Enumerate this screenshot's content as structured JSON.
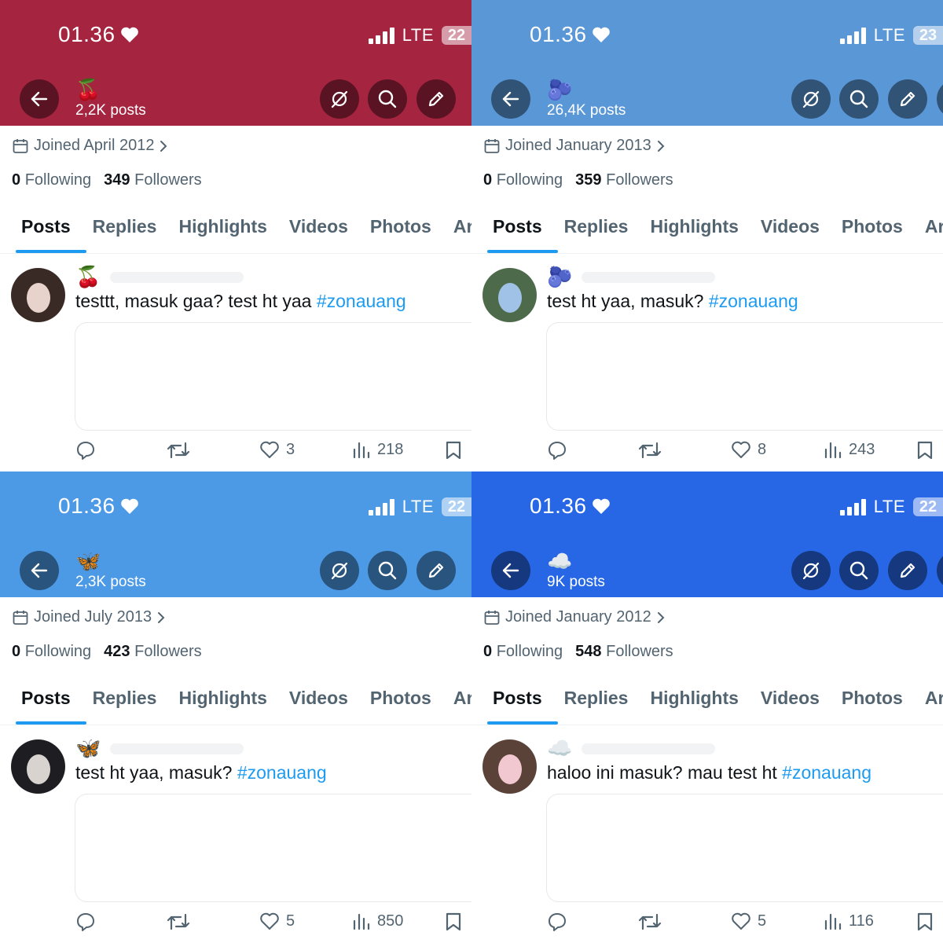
{
  "panels": [
    {
      "header_color": "#a52440",
      "time": "01.36",
      "network": "LTE",
      "battery": "22",
      "name_emoji": "🍒",
      "post_count": "2,2K posts",
      "joined": "Joined April 2012",
      "following_count": "0",
      "following_label": "Following",
      "followers_count": "349",
      "followers_label": "Followers",
      "tabs": [
        "Posts",
        "Replies",
        "Highlights",
        "Videos",
        "Photos",
        "Ar"
      ],
      "post": {
        "emoji": "🍒",
        "text": "testtt, masuk gaa? test ht yaa ",
        "hashtag": "#zonauang",
        "likes": "3",
        "views": "218"
      },
      "avatar_colors": [
        "#3a2a26",
        "#e7d3cb"
      ]
    },
    {
      "header_color": "#5a97d6",
      "time": "01.36",
      "network": "LTE",
      "battery": "23",
      "name_emoji": "🫐",
      "post_count": "26,4K posts",
      "joined": "Joined January 2013",
      "following_count": "0",
      "following_label": "Following",
      "followers_count": "359",
      "followers_label": "Followers",
      "tabs": [
        "Posts",
        "Replies",
        "Highlights",
        "Videos",
        "Photos",
        "Ar"
      ],
      "post": {
        "emoji": "🫐",
        "text": "test ht yaa, masuk? ",
        "hashtag": "#zonauang",
        "likes": "8",
        "views": "243"
      },
      "avatar_colors": [
        "#4d6a4a",
        "#9fc2e6"
      ]
    },
    {
      "header_color": "#4c9ae6",
      "time": "01.36",
      "network": "LTE",
      "battery": "22",
      "name_emoji": "🦋",
      "post_count": "2,3K posts",
      "joined": "Joined July 2013",
      "following_count": "0",
      "following_label": "Following",
      "followers_count": "423",
      "followers_label": "Followers",
      "tabs": [
        "Posts",
        "Replies",
        "Highlights",
        "Videos",
        "Photos",
        "Ar"
      ],
      "post": {
        "emoji": "🦋",
        "text": "test ht yaa, masuk? ",
        "hashtag": "#zonauang",
        "likes": "5",
        "views": "850"
      },
      "avatar_colors": [
        "#1e1e22",
        "#d9d3d0"
      ]
    },
    {
      "header_color": "#2767e6",
      "time": "01.36",
      "network": "LTE",
      "battery": "22",
      "name_emoji": "☁️",
      "post_count": "9K posts",
      "joined": "Joined January 2012",
      "following_count": "0",
      "following_label": "Following",
      "followers_count": "548",
      "followers_label": "Followers",
      "tabs": [
        "Posts",
        "Replies",
        "Highlights",
        "Videos",
        "Photos",
        "Ar"
      ],
      "post": {
        "emoji": "☁️",
        "text": "haloo ini masuk? mau test ht ",
        "hashtag": "#zonauang",
        "likes": "5",
        "views": "116"
      },
      "avatar_colors": [
        "#5a4238",
        "#f2c8d0"
      ]
    }
  ]
}
